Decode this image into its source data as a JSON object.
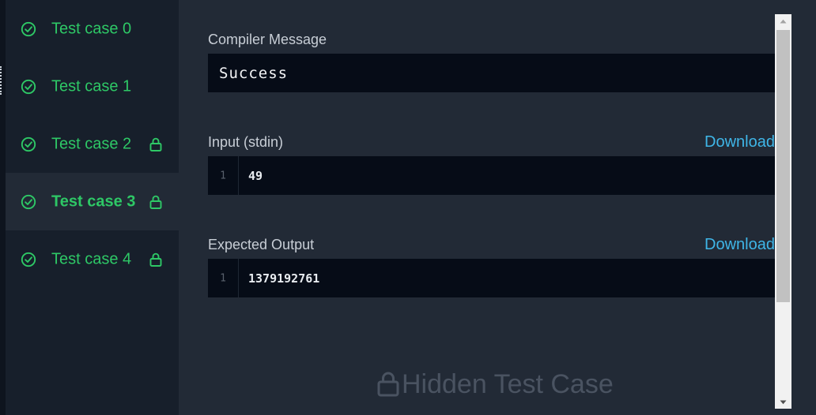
{
  "sidebar": {
    "items": [
      {
        "label": "Test case 0",
        "locked": false,
        "active": false
      },
      {
        "label": "Test case 1",
        "locked": false,
        "active": false
      },
      {
        "label": "Test case 2",
        "locked": true,
        "active": false
      },
      {
        "label": "Test case 3",
        "locked": true,
        "active": true
      },
      {
        "label": "Test case 4",
        "locked": true,
        "active": false
      }
    ]
  },
  "compiler": {
    "title": "Compiler Message",
    "message": "Success"
  },
  "input": {
    "title": "Input (stdin)",
    "download_label": "Download",
    "lines": [
      {
        "num": "1",
        "text": "49"
      }
    ]
  },
  "expected": {
    "title": "Expected Output",
    "download_label": "Download",
    "lines": [
      {
        "num": "1",
        "text": "1379192761"
      }
    ]
  },
  "hidden_banner": {
    "text": "Hidden Test Case",
    "icon": "lock-icon"
  },
  "colors": {
    "success_green": "#2ec866",
    "link_blue": "#3fb6e8",
    "panel_bg": "#222a36",
    "sidebar_bg": "#171f2b",
    "code_bg": "#060c17"
  }
}
